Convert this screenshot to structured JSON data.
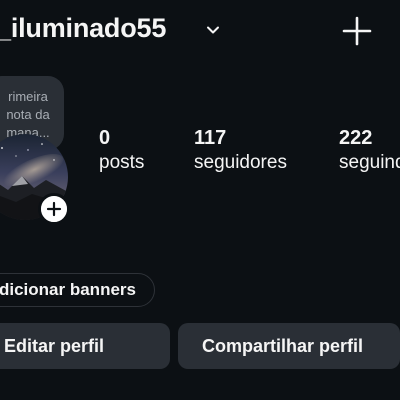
{
  "header": {
    "username": "_iluminado55",
    "dropdown_icon": "chevron-down-icon",
    "create_icon": "plus-icon"
  },
  "note": {
    "lines": [
      "rimeira",
      "nota da",
      "mana..."
    ]
  },
  "avatar": {
    "add_icon": "plus-icon"
  },
  "stats": {
    "posts": {
      "value": "0",
      "label": "posts"
    },
    "followers": {
      "value": "117",
      "label": "seguidores"
    },
    "following": {
      "value": "222",
      "label": "seguindo"
    }
  },
  "banners": {
    "label": "dicionar banners"
  },
  "actions": {
    "edit_label": "Editar perfil",
    "share_label": "Compartilhar perfil"
  },
  "colors": {
    "background": "#0c1014",
    "surface": "#2a2f36",
    "text": "#f5f5f5",
    "muted_text": "#a8adb4"
  }
}
